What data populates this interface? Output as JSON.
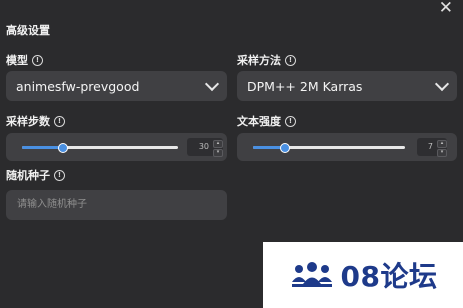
{
  "dialog": {
    "title": "高级设置",
    "close_icon": "close-icon"
  },
  "model": {
    "label": "模型",
    "value": "animesfw-prevgood"
  },
  "sampler": {
    "label": "采样方法",
    "value": "DPM++ 2M Karras"
  },
  "steps": {
    "label": "采样步数",
    "value": "30",
    "fraction": 0.26
  },
  "cfg": {
    "label": "文本强度",
    "value": "7",
    "fraction": 0.21
  },
  "seed": {
    "label": "随机种子",
    "placeholder": "请输入随机种子"
  },
  "watermark": {
    "text": "08论坛",
    "icon": "people-logo-icon"
  },
  "colors": {
    "background": "#2b2b2d",
    "control": "#404043",
    "accent": "#4a90e2",
    "watermark_text": "#1e3a8a"
  }
}
